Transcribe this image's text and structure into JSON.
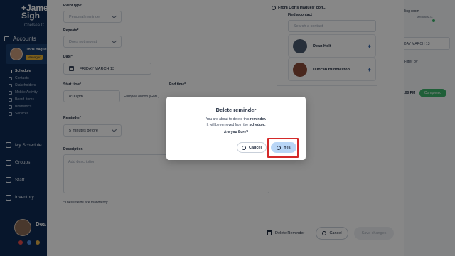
{
  "app": {
    "logo_line1": "+Jame",
    "logo_line2": "Sigh",
    "org_name": "Chelsea C"
  },
  "sidebar": {
    "accounts_label": "Accounts",
    "account_name": "Doris Hagues",
    "account_badge": "Manager",
    "sub_items": [
      {
        "label": "Schedule",
        "active": true
      },
      {
        "label": "Contacts",
        "active": false
      },
      {
        "label": "Stakeholders",
        "active": false
      },
      {
        "label": "Mobile Activity",
        "active": false
      },
      {
        "label": "Board Items",
        "active": false
      },
      {
        "label": "Biometrics",
        "active": false
      },
      {
        "label": "Services",
        "active": false
      }
    ],
    "nav_items": [
      {
        "label": "My Schedule",
        "icon": "calendar-icon"
      },
      {
        "label": "Groups",
        "icon": "groups-icon"
      },
      {
        "label": "Staff",
        "icon": "staff-icon"
      },
      {
        "label": "Inventory",
        "icon": "box-icon"
      }
    ],
    "profile_name": "Dea"
  },
  "background_right": {
    "room_label": "lling room",
    "room_sub": "Medical M.D.",
    "date_field": "DAY MARCH 13",
    "filter_label": "Filter by",
    "time": ":00 PM",
    "status_pill": "Completed"
  },
  "form": {
    "event_type_label": "Event type*",
    "event_type_value": "Personal reminder",
    "repeats_label": "Repeats*",
    "repeats_value": "Does not repeat",
    "date_label": "Date*",
    "date_value": "FRIDAY MARCH 13",
    "start_time_label": "Start time*",
    "start_time_value": "8:00 pm",
    "start_timezone": "Europe/London (GMT)",
    "end_time_label": "End time*",
    "reminder_label": "Reminder*",
    "reminder_value": "5 minutes before",
    "description_label": "Description",
    "description_placeholder": "Add description",
    "mandatory_note": "*These fields are mandatory."
  },
  "contacts": {
    "header": "From Doris Hagues' con...",
    "find_label": "Find a contact",
    "search_placeholder": "Search a contact",
    "items": [
      {
        "name": "Dean Holt",
        "avatar_color": "#4a5a6e"
      },
      {
        "name": "Duncan Hubbleston",
        "avatar_color": "#8a4a38"
      }
    ]
  },
  "footer": {
    "delete_label": "Delete Reminder",
    "cancel_label": "Cancel",
    "save_label": "Save changes"
  },
  "dialog": {
    "title": "Delete reminder",
    "line1_prefix": "You are about to delete this",
    "line1_bold": "reminder.",
    "line2_prefix": "It will be removed from the",
    "line2_bold": "schedule.",
    "question": "Are you Sure?",
    "cancel_label": "Cancel",
    "yes_label": "Yes"
  },
  "colors": {
    "sidebar_bg": "#0f2b53",
    "highlight": "#d42a2a",
    "yes_button": "#b9d6f6",
    "completed": "#3bb36b"
  }
}
